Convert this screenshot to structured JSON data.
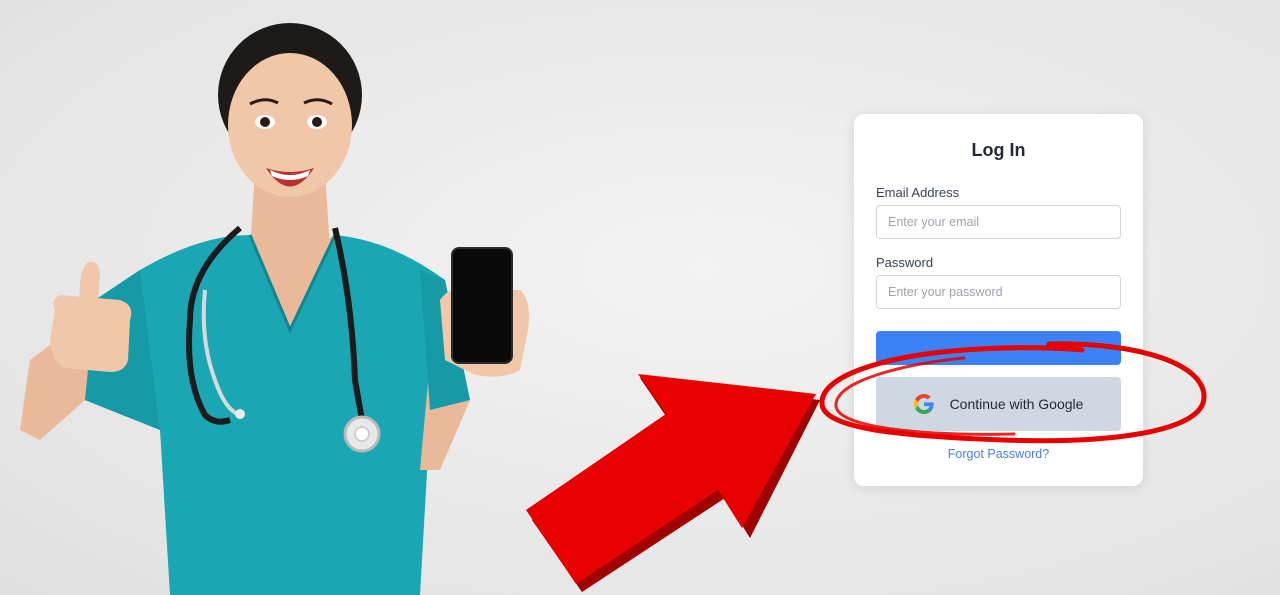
{
  "login": {
    "title": "Log In",
    "email_label": "Email Address",
    "email_placeholder": "Enter your email",
    "email_value": "",
    "password_label": "Password",
    "password_placeholder": "Enter your password",
    "password_value": "",
    "login_button_label": "",
    "google_button_label": "Continue with Google",
    "forgot_link_label": "Forgot Password?"
  },
  "colors": {
    "primary_button": "#3b82f6",
    "google_button_bg": "#cfd7e2",
    "link": "#4a7fd6",
    "annotation_red": "#e60000",
    "scrubs": "#1aa7b3"
  },
  "icons": {
    "google": "google-icon",
    "arrow": "red-arrow-icon"
  }
}
